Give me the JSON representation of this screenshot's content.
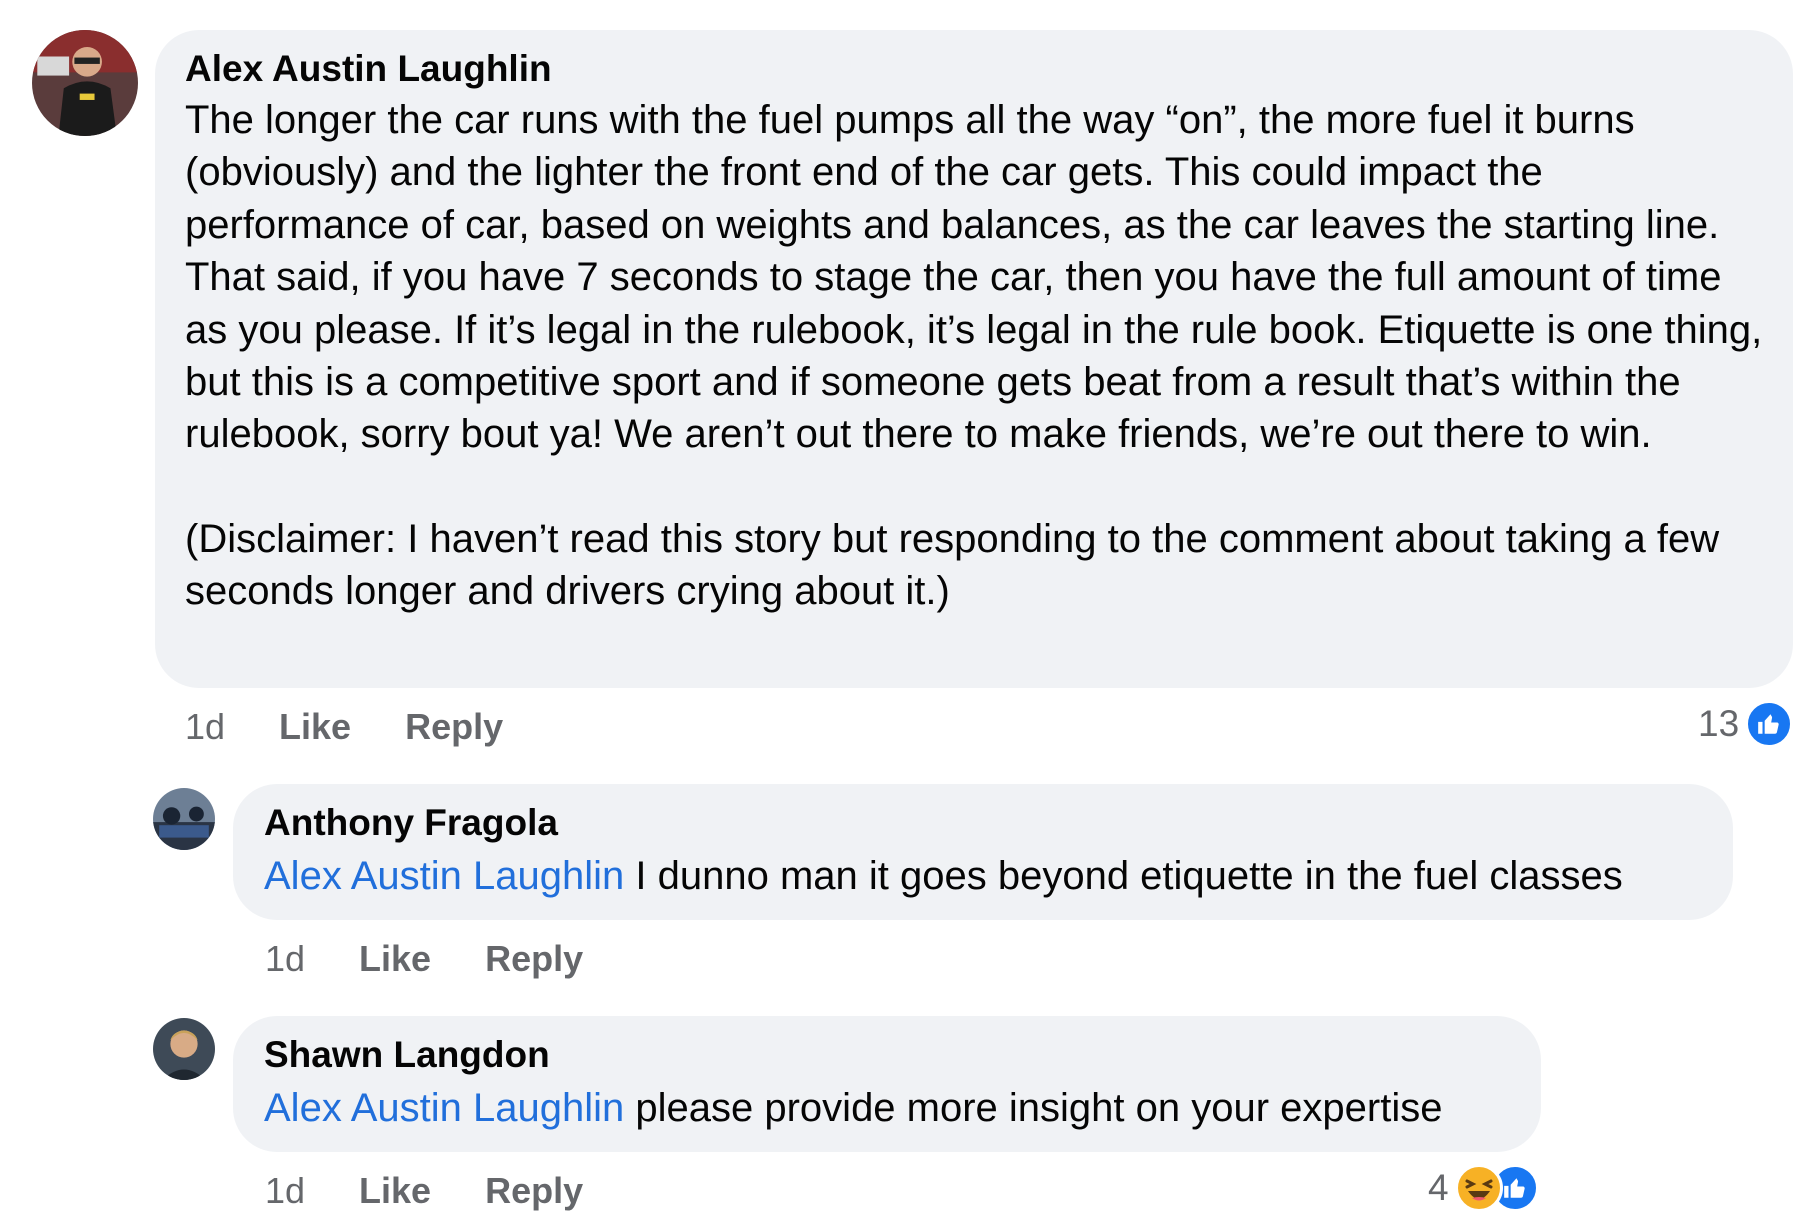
{
  "comments": [
    {
      "author": "Alex Austin Laughlin",
      "paragraphs": [
        "The longer the car runs with the fuel pumps all the way “on”, the more fuel it burns (obviously) and the lighter the front end of the car gets. This could impact the performance of car, based on weights and balances, as the car leaves the starting line. That said, if you have 7 seconds to stage the car, then you have the full amount of time as you please. If it’s legal in the rulebook, it’s legal in the rule book. Etiquette is one thing, but this is a competitive sport and if someone gets beat from a result that’s within the rulebook, sorry bout ya! We aren’t out there to make friends, we’re out there to win.",
        "(Disclaimer: I haven’t read this story but responding to the comment about taking a few seconds longer and drivers crying about it.)"
      ],
      "time": "1d",
      "like_label": "Like",
      "reply_label": "Reply",
      "reaction_count": "13",
      "reactions": [
        "like-icon"
      ]
    },
    {
      "author": "Anthony Fragola",
      "mention": "Alex Austin Laughlin",
      "text": " I dunno man it goes beyond etiquette in the fuel classes",
      "time": "1d",
      "like_label": "Like",
      "reply_label": "Reply"
    },
    {
      "author": "Shawn Langdon",
      "mention": "Alex Austin Laughlin",
      "text": " please provide more insight on your expertise",
      "time": "1d",
      "like_label": "Like",
      "reply_label": "Reply",
      "reaction_count": "4",
      "reactions": [
        "haha-icon",
        "like-icon"
      ]
    }
  ],
  "colors": {
    "bubble": "#f0f2f5",
    "mention": "#216fdb",
    "meta": "#65676b",
    "like": "#1877f2",
    "haha": "#f7b125"
  }
}
